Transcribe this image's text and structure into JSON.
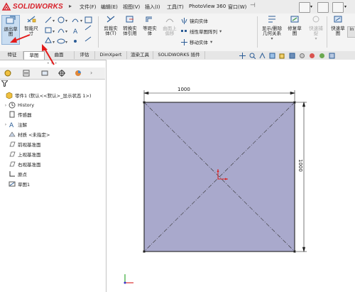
{
  "app": {
    "brand": "SOLIDWORKS",
    "brand_color": "#d8202a"
  },
  "menu": {
    "items": [
      {
        "label": "文件(F)"
      },
      {
        "label": "编辑(E)"
      },
      {
        "label": "视图(V)"
      },
      {
        "label": "插入(I)"
      },
      {
        "label": "工具(T)"
      },
      {
        "label": "PhotoView 360"
      },
      {
        "label": "窗口(W)"
      }
    ]
  },
  "ribbon": {
    "exit_sketch": "退出草\n图",
    "smart_dimension": "智能尺\n寸",
    "trim": "剪裁实\n体(T)",
    "convert": "转换实\n体引用",
    "offset": "等距实\n体",
    "surface_offset": "曲面上\n偏移",
    "mirror": "镜向实体",
    "linear_pattern": "线性草图阵列",
    "move": "移动实体",
    "show_hide": "显示/删除\n几何关系",
    "repair": "修复草\n图",
    "quick_snap": "快速捕\n捉",
    "quick_view": "快速草\n图",
    "extra": "In"
  },
  "tabs": [
    {
      "label": "特征"
    },
    {
      "label": "草图"
    },
    {
      "label": "曲面"
    },
    {
      "label": "评估"
    },
    {
      "label": "DimXpert"
    },
    {
      "label": "渲染工具"
    },
    {
      "label": "SOLIDWORKS 插件"
    }
  ],
  "tree": {
    "root": "零件1  (默认<<默认>_显示状态 1>)",
    "items": [
      {
        "label": "History"
      },
      {
        "label": "传感器"
      },
      {
        "label": "注解"
      },
      {
        "label": "材质 <未指定>"
      },
      {
        "label": "前视基准面"
      },
      {
        "label": "上视基准面"
      },
      {
        "label": "右视基准面"
      },
      {
        "label": "原点"
      },
      {
        "label": "草图1"
      }
    ]
  },
  "sketch": {
    "width_dim": "1000",
    "height_dim": "1000",
    "fill_color": "#a9a9cc"
  }
}
